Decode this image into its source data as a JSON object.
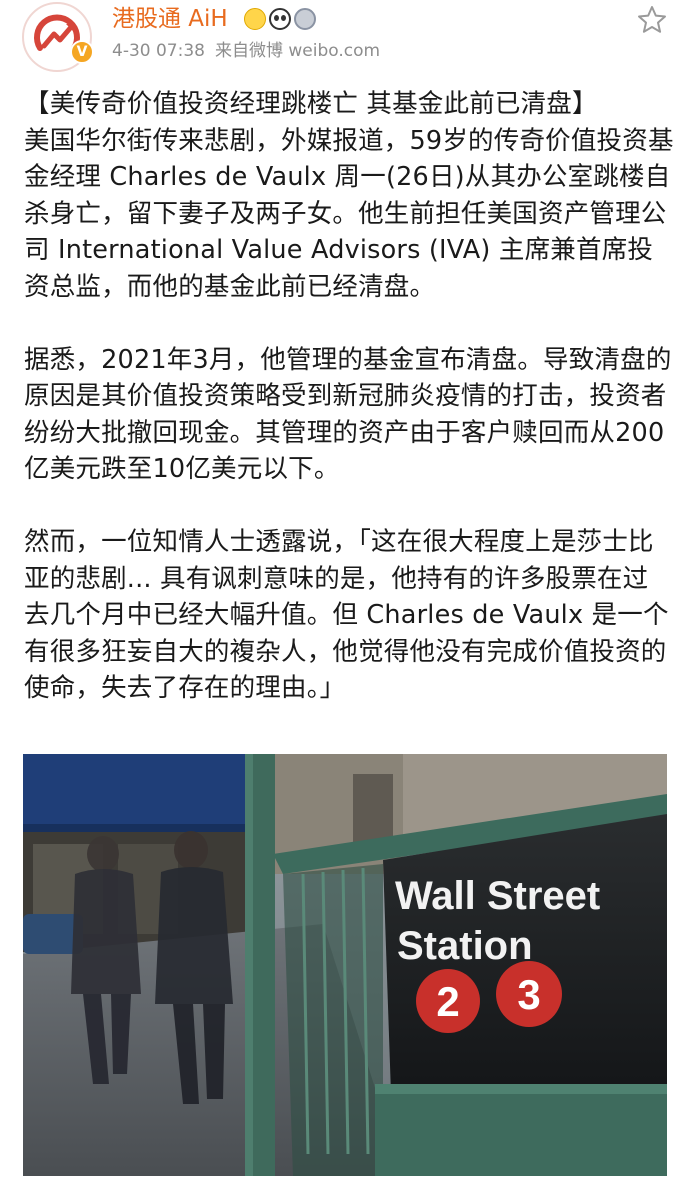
{
  "post": {
    "username": "港股通 AiH",
    "verified_badge": "V",
    "badges": [
      "crown-icon",
      "panda-icon",
      "round-badge-icon"
    ],
    "timestamp": "4-30 07:38",
    "source": "来自微博 weibo.com",
    "favorite_icon": "star-outline-icon"
  },
  "content": {
    "title": "【美传奇价值投资经理跳楼亡 其基金此前已清盘】",
    "paragraph1": "美国华尔街传来悲剧，外媒报道，59岁的传奇价值投资基金经理 Charles de Vaulx 周一(26日)从其办公室跳楼自杀身亡，留下妻子及两子女。他生前担任美国资产管理公司 International Value Advisors (IVA) 主席兼首席投资总监，而他的基金此前已经清盘。",
    "paragraph2": "据悉，2021年3月，他管理的基金宣布清盘。导致清盘的原因是其价值投资策略受到新冠肺炎疫情的打击，投资者纷纷大批撤回现金。其管理的资产由于客户赎回而从200亿美元跌至10亿美元以下。",
    "paragraph3": "然而，一位知情人士透露说，「这在很大程度上是莎士比亚的悲剧... 具有讽刺意味的是，他持有的许多股票在过去几个月中已经大幅升值。但 Charles de Vaulx 是一个有很多狂妄自大的複杂人，他觉得他没有完成价值投资的使命，失去了存在的理由。」"
  },
  "photo": {
    "sign_line1": "Wall Street",
    "sign_line2": "Station",
    "route1": "2",
    "route2": "3",
    "route_color": "#c8302b"
  },
  "colors": {
    "username": "#e86b1f",
    "meta": "#8d8d8d",
    "text": "#1a1a1a"
  }
}
